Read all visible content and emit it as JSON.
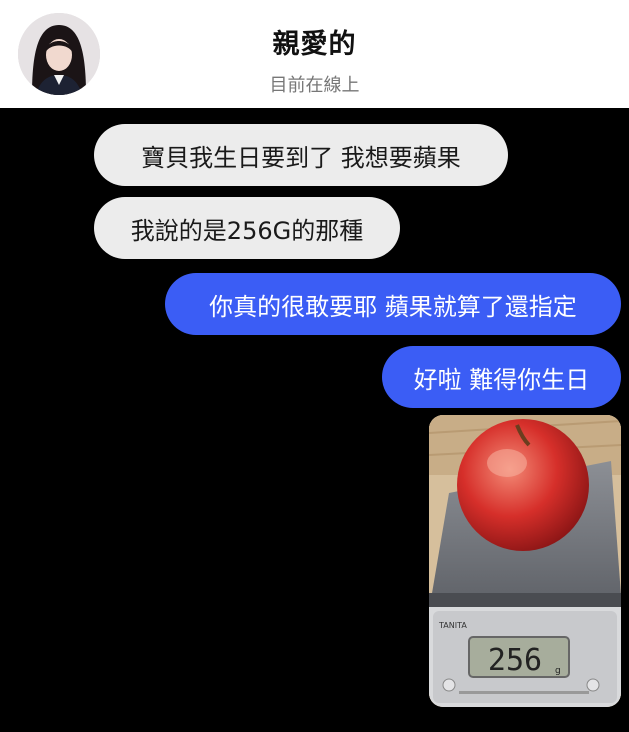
{
  "header": {
    "title": "親愛的",
    "status": "目前在線上"
  },
  "messages": [
    {
      "from": "them",
      "text": "寶貝我生日要到了 我想要蘋果"
    },
    {
      "from": "them",
      "text": "我說的是256G的那種"
    },
    {
      "from": "me",
      "text": "你真的很敢要耶 蘋果就算了還指定"
    },
    {
      "from": "me",
      "text": "好啦 難得你生日"
    }
  ],
  "photo": {
    "scale_display": "256",
    "scale_unit": "g",
    "scale_brand": "TANITA"
  },
  "colors": {
    "background": "#000000",
    "incoming_bubble": "#ececec",
    "outgoing_bubble": "#3b5df5"
  }
}
